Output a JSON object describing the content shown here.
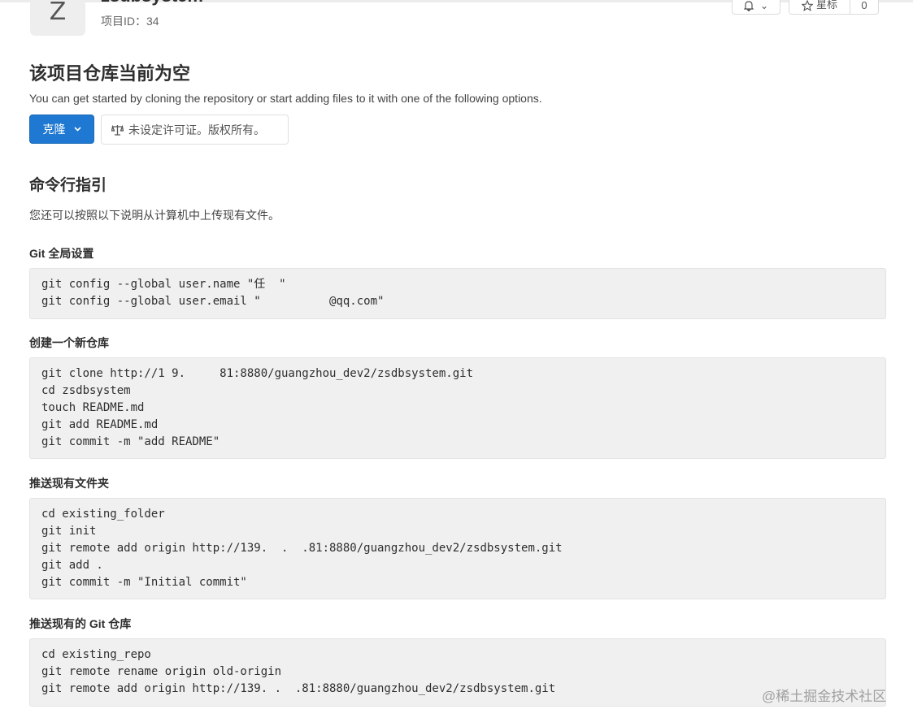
{
  "header": {
    "avatar_letter": "Z",
    "project_name": "zsdbsystem",
    "project_id": "项目ID：34",
    "notification_caret": "⌄",
    "star_label": "星标",
    "star_count": "0"
  },
  "empty_repo": {
    "title": "该项目仓库当前为空",
    "description": "You can get started by cloning the repository or start adding files to it with one of the following options.",
    "clone_label": "克隆",
    "license_label": "未设定许可证。版权所有。"
  },
  "cli": {
    "title": "命令行指引",
    "description": "您还可以按照以下说明从计算机中上传现有文件。",
    "sections": [
      {
        "title": "Git 全局设置",
        "lines": [
          "git config --global user.name \"任  \"",
          "git config --global user.email \"          @qq.com\""
        ]
      },
      {
        "title": "创建一个新仓库",
        "lines": [
          "git clone http://1 9.     81:8880/guangzhou_dev2/zsdbsystem.git",
          "cd zsdbsystem",
          "touch README.md",
          "git add README.md",
          "git commit -m \"add README\""
        ]
      },
      {
        "title": "推送现有文件夹",
        "lines": [
          "cd existing_folder",
          "git init",
          "git remote add origin http://139.  .  .81:8880/guangzhou_dev2/zsdbsystem.git",
          "git add .",
          "git commit -m \"Initial commit\""
        ]
      },
      {
        "title": "推送现有的 Git 仓库",
        "lines": [
          "cd existing_repo",
          "git remote rename origin old-origin",
          "git remote add origin http://139. .  .81:8880/guangzhou_dev2/zsdbsystem.git"
        ]
      }
    ]
  },
  "watermark": "@稀土掘金技术社区",
  "colors": {
    "primary_button": "#1f78d1",
    "code_background": "#f0f0f0"
  }
}
